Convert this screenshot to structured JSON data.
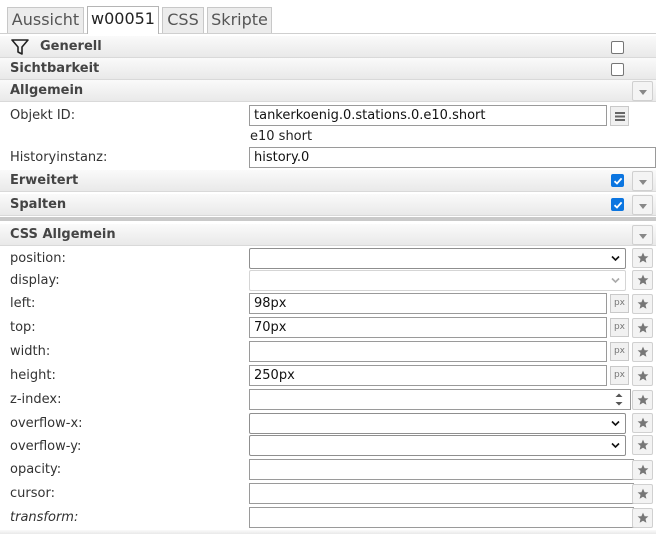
{
  "tabs": [
    {
      "label": "Aussicht",
      "active": false
    },
    {
      "label": "w00051",
      "active": true
    },
    {
      "label": "CSS",
      "active": false
    },
    {
      "label": "Skripte",
      "active": false
    }
  ],
  "groups": {
    "generell": "Generell",
    "sichtbarkeit": "Sichtbarkeit",
    "allgemein": "Allgemein",
    "erweitert": "Erweitert",
    "spalten": "Spalten",
    "css_allgemein": "CSS Allgemein"
  },
  "allgemein": {
    "objekt_id_label": "Objekt ID:",
    "objekt_id_value": "tankerkoenig.0.stations.0.e10.short",
    "objekt_name": "e10 short",
    "historyinstanz_label": "Historyinstanz:",
    "historyinstanz_value": "history.0"
  },
  "checks": {
    "generell": false,
    "sichtbarkeit": false,
    "erweitert": true,
    "spalten": true
  },
  "css": {
    "position_label": "position:",
    "position_value": "",
    "display_label": "display:",
    "display_value": "",
    "left_label": "left:",
    "left_value": "98px",
    "top_label": "top:",
    "top_value": "70px",
    "width_label": "width:",
    "width_value": "",
    "height_label": "height:",
    "height_value": "250px",
    "zindex_label": "z-index:",
    "zindex_value": "",
    "overflowx_label": "overflow-x:",
    "overflowx_value": "",
    "overflowy_label": "overflow-y:",
    "overflowy_value": "",
    "opacity_label": "opacity:",
    "opacity_value": "",
    "cursor_label": "cursor:",
    "cursor_value": "",
    "transform_label": "transform:",
    "transform_value": "",
    "unit": "px"
  },
  "colors": {
    "accent": "#0b75e0"
  }
}
